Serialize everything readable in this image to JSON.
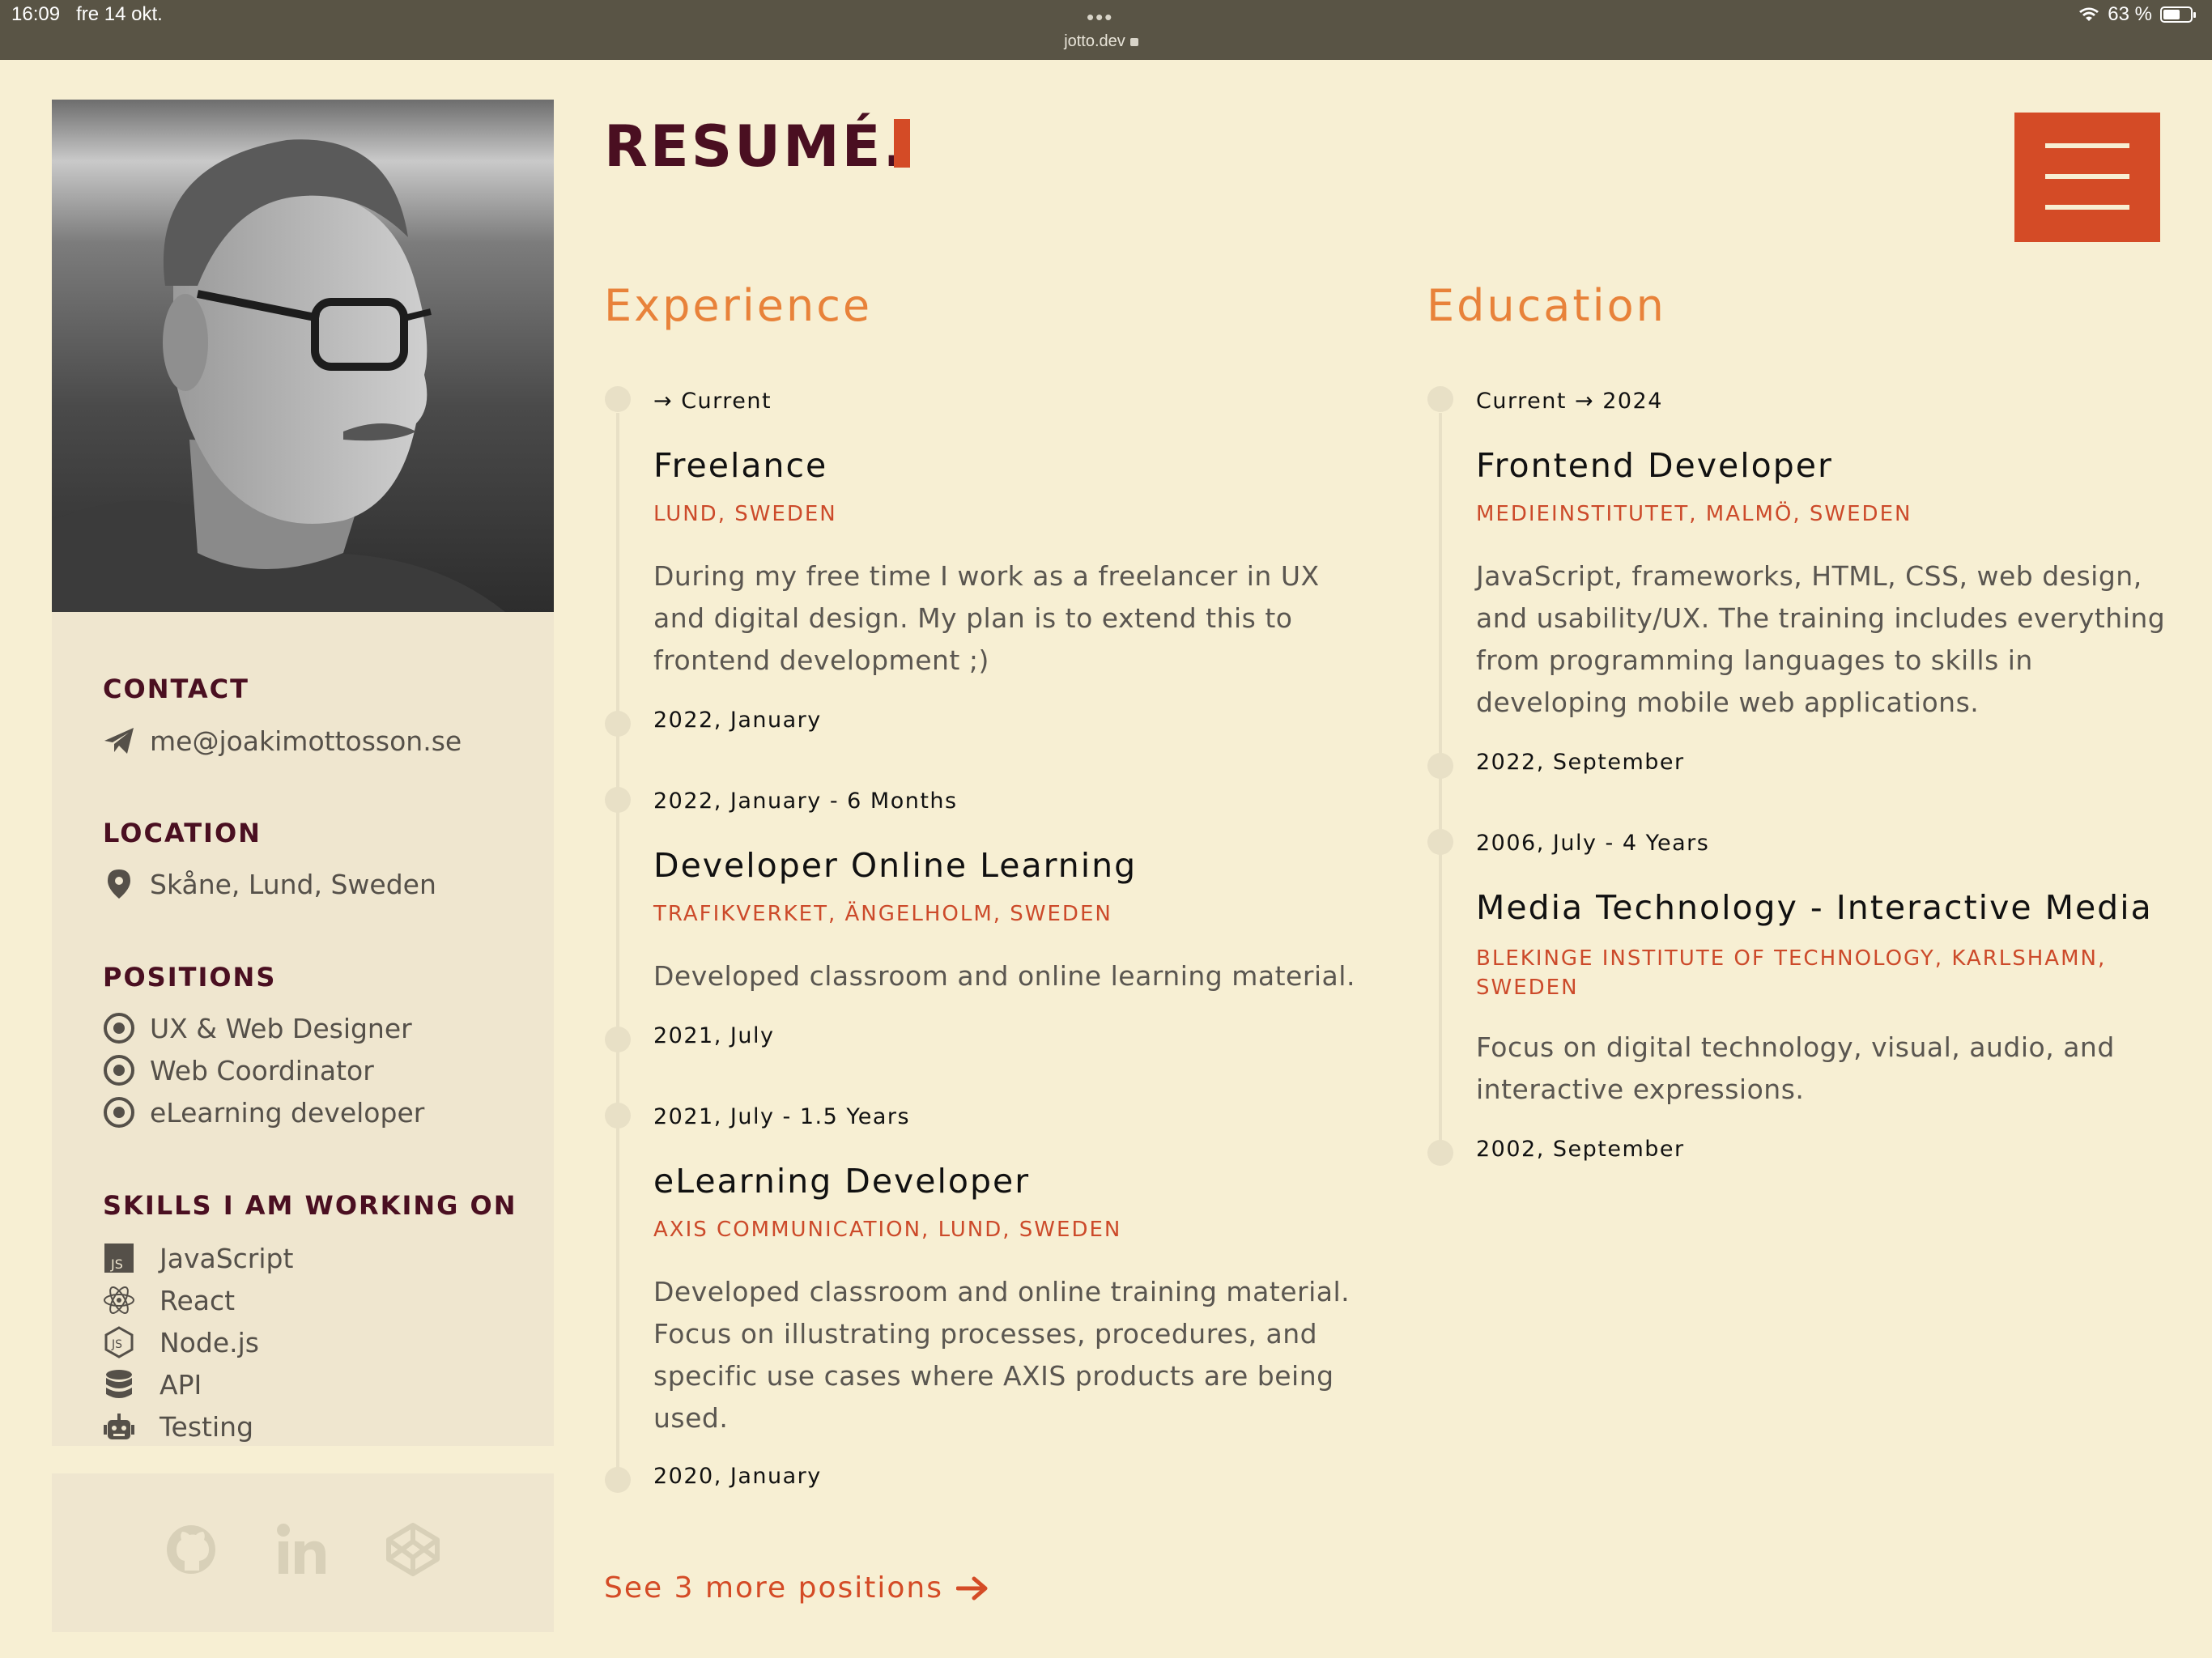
{
  "status": {
    "time": "16:09",
    "date": "fre 14 okt.",
    "url": "jotto.dev",
    "battery": "63 %",
    "battery_level": 0.63
  },
  "profile": {
    "photo_icon": "portrait-photo"
  },
  "sidebar": {
    "contact_heading": "CONTACT",
    "email": "me@joakimottosson.se",
    "location_heading": "LOCATION",
    "location": "Skåne, Lund, Sweden",
    "positions_heading": "POSITIONS",
    "positions": [
      "UX & Web Designer",
      "Web Coordinator",
      "eLearning developer"
    ],
    "skills_heading": "SKILLS I AM WORKING ON",
    "skills": [
      {
        "label": "JavaScript",
        "icon": "javascript-icon"
      },
      {
        "label": "React",
        "icon": "react-icon"
      },
      {
        "label": "Node.js",
        "icon": "nodejs-icon"
      },
      {
        "label": "API",
        "icon": "database-icon"
      },
      {
        "label": "Testing",
        "icon": "robot-icon"
      }
    ]
  },
  "social": [
    "github-icon",
    "linkedin-icon",
    "codepen-icon"
  ],
  "header": {
    "title": "RESUMÉ.",
    "menu_icon": "hamburger-menu-icon"
  },
  "experience": {
    "heading": "Experience",
    "items": [
      {
        "start": "→ Current",
        "title": "Freelance",
        "place": "LUND, SWEDEN",
        "desc": "During my free time I work as a freelancer in UX and digital design. My plan is to extend this to frontend development ;)",
        "end": "2022, January"
      },
      {
        "start": "2022, January - 6 Months",
        "title": "Developer Online Learning",
        "place": "TRAFIKVERKET, ÄNGELHOLM, SWEDEN",
        "desc": "Developed classroom and online learning material.",
        "end": "2021, July"
      },
      {
        "start": "2021, July - 1.5 Years",
        "title": "eLearning Developer",
        "place": "AXIS COMMUNICATION, LUND, SWEDEN",
        "desc": "Developed classroom and online training material. Focus on illustrating processes, procedures, and specific use cases where AXIS products are being used.",
        "end": "2020, January"
      }
    ],
    "more": "See 3 more positions"
  },
  "education": {
    "heading": "Education",
    "items": [
      {
        "start": "Current → 2024",
        "title": "Frontend Developer",
        "place": "MEDIEINSTITUTET, MALMÖ, SWEDEN",
        "desc": "JavaScript, frameworks, HTML, CSS, web design, and usability/UX. The training includes everything from programming languages to skills in developing mobile web applications.",
        "end": "2022, September"
      },
      {
        "start": "2006, July - 4 Years",
        "title": "Media Technology - Interactive Media",
        "place": "BLEKINGE INSTITUTE OF TECHNOLOGY, KARLSHAMN, SWEDEN",
        "desc": "Focus on digital technology, visual, audio, and interactive expressions.",
        "end": "2002, September"
      }
    ]
  },
  "colors": {
    "background": "#f7efd3",
    "accent": "#d44b26",
    "heading": "#4a0f21",
    "section": "#e8823a"
  }
}
